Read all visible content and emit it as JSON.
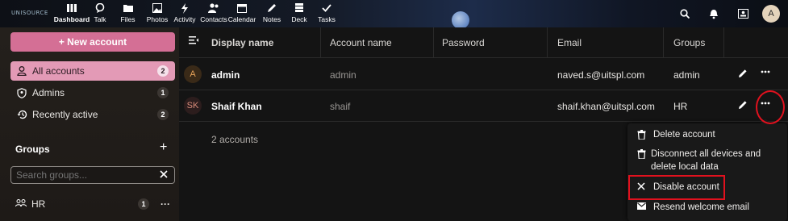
{
  "topbar": {
    "logo": "UNISOURCE",
    "apps": [
      {
        "label": "Dashboard",
        "icon": "dashboard-icon",
        "active": true
      },
      {
        "label": "Talk",
        "icon": "talk-icon"
      },
      {
        "label": "Files",
        "icon": "files-icon"
      },
      {
        "label": "Photos",
        "icon": "photos-icon"
      },
      {
        "label": "Activity",
        "icon": "activity-icon"
      },
      {
        "label": "Contacts",
        "icon": "contacts-icon"
      },
      {
        "label": "Calendar",
        "icon": "calendar-icon"
      },
      {
        "label": "Notes",
        "icon": "notes-icon"
      },
      {
        "label": "Deck",
        "icon": "deck-icon"
      },
      {
        "label": "Tasks",
        "icon": "tasks-icon"
      }
    ],
    "avatar_initial": "A"
  },
  "sidebar": {
    "new_account": "+ New account",
    "items": [
      {
        "label": "All accounts",
        "count": "2",
        "icon": "account-icon"
      },
      {
        "label": "Admins",
        "count": "1",
        "icon": "shield-account-icon"
      },
      {
        "label": "Recently active",
        "count": "2",
        "icon": "history-icon"
      }
    ],
    "groups_heading": "Groups",
    "add_group": "+",
    "search_placeholder": "Search groups...",
    "groups": [
      {
        "label": "HR",
        "count": "1",
        "more": "···"
      }
    ]
  },
  "table": {
    "headers": {
      "display_name": "Display name",
      "account_name": "Account name",
      "password": "Password",
      "email": "Email",
      "groups": "Groups"
    },
    "rows": [
      {
        "initials": "A",
        "display_name": "admin",
        "account_name": "admin",
        "email": "naved.s@uitspl.com",
        "groups": "admin"
      },
      {
        "initials": "SK",
        "display_name": "Shaif Khan",
        "account_name": "shaif",
        "email": "shaif.khan@uitspl.com",
        "groups": "HR"
      }
    ],
    "count_text": "2 accounts"
  },
  "menu": {
    "items": [
      {
        "label": "Delete account",
        "icon": "trash-icon"
      },
      {
        "label": "Disconnect all devices and delete local data",
        "icon": "trash-icon"
      },
      {
        "label": "Disable account",
        "icon": "close-icon"
      },
      {
        "label": "Resend welcome email",
        "icon": "email-icon"
      }
    ]
  },
  "colors": {
    "accent_pink": "#d46f95",
    "highlight": "#e1111e"
  }
}
